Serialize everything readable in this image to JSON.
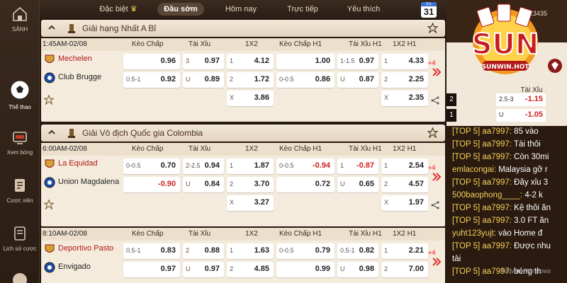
{
  "sidebar": {
    "top": "SẢNH",
    "items": [
      {
        "label": "Thể thao",
        "icon": "soccer-ball-icon"
      },
      {
        "label": "Xem bóng",
        "icon": "live-tv-icon"
      },
      {
        "label": "Cược xiên",
        "icon": "parlay-icon"
      },
      {
        "label": "Lịch sử cược",
        "icon": "history-icon"
      }
    ]
  },
  "tabs": [
    "Đặc biệt",
    "Đầu sớm",
    "Hôm nay",
    "Trực tiếp",
    "Yêu thích"
  ],
  "calendar": {
    "month": "JUL",
    "day": "31"
  },
  "columns": [
    "Kèo Chấp",
    "Tài Xỉu",
    "1X2",
    "Kèo Chấp H1",
    "Tài Xỉu H1",
    "1X2 H1"
  ],
  "leagues": [
    {
      "name": "Giải hạng Nhất A Bỉ"
    },
    {
      "name": "Giải Vô địch Quốc gia Colombia"
    }
  ],
  "matches": [
    {
      "time": "1:45AM-02/08",
      "home": "Mechelen",
      "away": "Club Brugge",
      "more": "+4",
      "rows": [
        [
          [
            "",
            "0.96"
          ],
          [
            "3",
            "0.97"
          ],
          [
            "1",
            "4.12"
          ],
          [
            "",
            "1.00"
          ],
          [
            "1-1.5",
            "0.97"
          ],
          [
            "1",
            "4.33"
          ]
        ],
        [
          [
            "0.5-1",
            "0.92"
          ],
          [
            "U",
            "0.89"
          ],
          [
            "2",
            "1.72"
          ],
          [
            "0-0.5",
            "0.86"
          ],
          [
            "U",
            "0.87"
          ],
          [
            "2",
            "2.25"
          ]
        ],
        [
          null,
          null,
          [
            "X",
            "3.86"
          ],
          null,
          null,
          [
            "X",
            "2.35"
          ]
        ]
      ]
    },
    {
      "time": "6:00AM-02/08",
      "home": "La Equidad",
      "away": "Union Magdalena",
      "more": "+4",
      "rows": [
        [
          [
            "0-0.5",
            "0.70"
          ],
          [
            "2-2.5",
            "0.94"
          ],
          [
            "1",
            "1.87"
          ],
          [
            "0-0.5",
            "-0.94"
          ],
          [
            "1",
            "-0.87"
          ],
          [
            "1",
            "2.54"
          ]
        ],
        [
          [
            "",
            "-0.90"
          ],
          [
            "U",
            "0.84"
          ],
          [
            "2",
            "3.70"
          ],
          [
            "",
            "0.72"
          ],
          [
            "U",
            "0.65"
          ],
          [
            "2",
            "4.57"
          ]
        ],
        [
          null,
          null,
          [
            "X",
            "3.27"
          ],
          null,
          null,
          [
            "X",
            "1.97"
          ]
        ]
      ]
    },
    {
      "time": "8:10AM-02/08",
      "home": "Deportivo Pasto",
      "away": "Envigado",
      "more": "+4",
      "rows": [
        [
          [
            "0.5-1",
            "0.83"
          ],
          [
            "2",
            "0.88"
          ],
          [
            "1",
            "1.63"
          ],
          [
            "0-0.5",
            "0.79"
          ],
          [
            "0.5-1",
            "0.82"
          ],
          [
            "1",
            "2.21"
          ]
        ],
        [
          [
            "",
            "0.97"
          ],
          [
            "U",
            "0.97"
          ],
          [
            "2",
            "4.85"
          ],
          [
            "",
            "0.99"
          ],
          [
            "U",
            "0.98"
          ],
          [
            "2",
            "7.00"
          ]
        ]
      ]
    }
  ],
  "right_panel": {
    "username": "tiendat23435",
    "logo_text": "SUN",
    "logo_sub": "SUNWIN.HOT",
    "mini_header": "Tài Xỉu",
    "mini_rows": [
      {
        "side": "2",
        "h": "2.5-3",
        "o": "-1.15"
      },
      {
        "side": "1",
        "h": "U",
        "o": "-1.05"
      }
    ]
  },
  "chat": [
    {
      "who": "[TOP 5] aa7997:",
      "msg": " 85 vào"
    },
    {
      "who": "[TOP 5] aa7997:",
      "msg": " Tài thôi"
    },
    {
      "who": "[TOP 5] aa7997:",
      "msg": " Còn 30mi"
    },
    {
      "who": "emlacongai:",
      "msg": " Malaysia gỡ r"
    },
    {
      "who": "[TOP 5] aa7997:",
      "msg": " Đây xỉu 3"
    },
    {
      "who": "500baophong____:",
      "msg": " 4-2 k"
    },
    {
      "who": "[TOP 5] aa7997:",
      "msg": " Kệ thôi ăn"
    },
    {
      "who": "[TOP 5] aa7997:",
      "msg": " 3.0 FT ăn"
    },
    {
      "who": "yuht123yujt:",
      "msg": " vào Home đ"
    },
    {
      "who": "[TOP 5] aa7997:",
      "msg": " Được nhu"
    },
    {
      "who": "",
      "msg": "tài"
    },
    {
      "who": "[TOP 5] aa7997:",
      "msg": " bóng th"
    }
  ],
  "watermark": "Activate Windows",
  "colors": {
    "accent": "#f5d15a",
    "negative": "#d02020",
    "home_team": "#b01818"
  }
}
